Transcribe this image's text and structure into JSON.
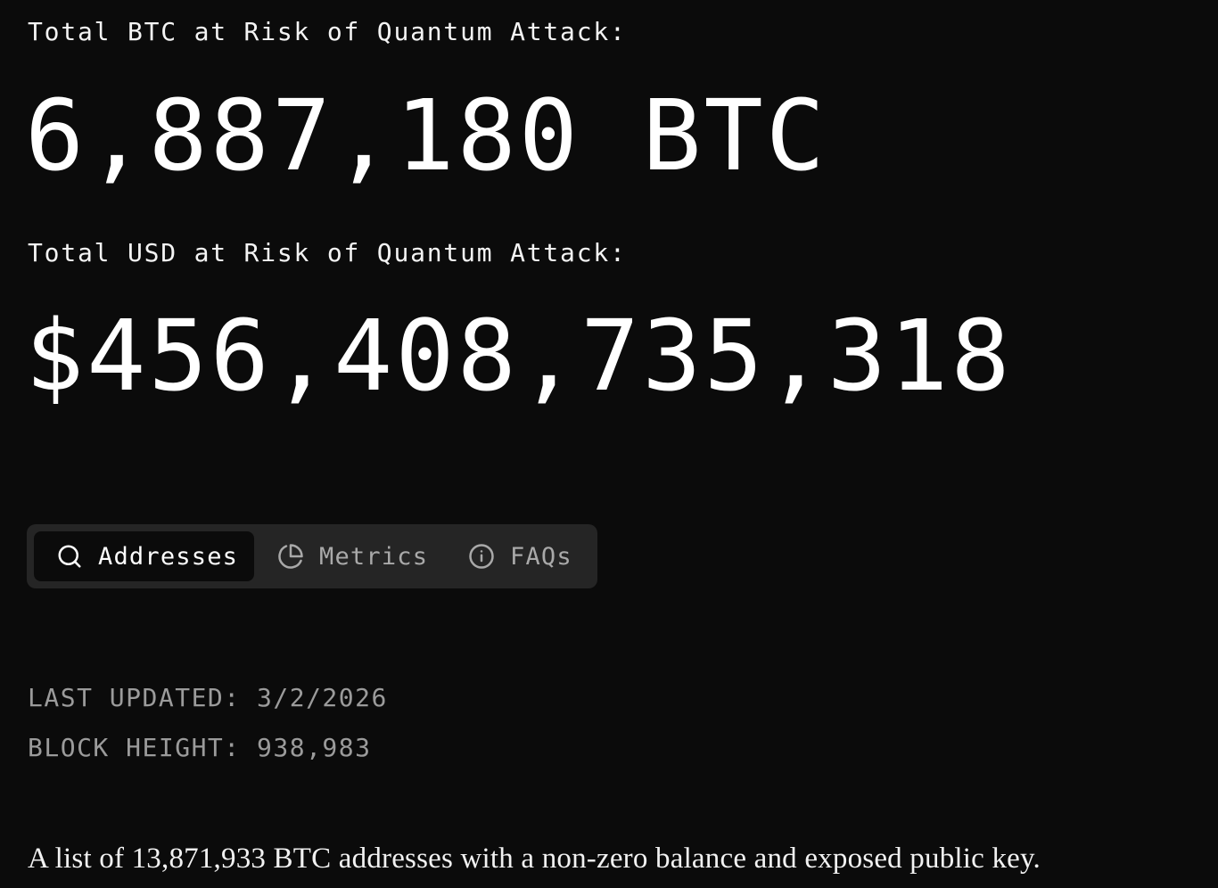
{
  "stats": {
    "btc_label": "Total BTC at Risk of Quantum Attack:",
    "btc_value": "6,887,180 BTC",
    "usd_label": "Total USD at Risk of Quantum Attack:",
    "usd_value": "$456,408,735,318"
  },
  "tabs": [
    {
      "label": "Addresses",
      "icon": "search-icon",
      "active": true
    },
    {
      "label": "Metrics",
      "icon": "pie-chart-icon",
      "active": false
    },
    {
      "label": "FAQs",
      "icon": "info-icon",
      "active": false
    }
  ],
  "meta": {
    "last_updated": "LAST UPDATED: 3/2/2026",
    "block_height": "BLOCK HEIGHT: 938,983"
  },
  "description": "A list of 13,871,933 BTC addresses with a non-zero balance and exposed public key.",
  "colors": {
    "background": "#0b0b0b",
    "tab_bar": "#252525",
    "text_primary": "#ffffff",
    "text_muted": "#9b9b9b"
  }
}
